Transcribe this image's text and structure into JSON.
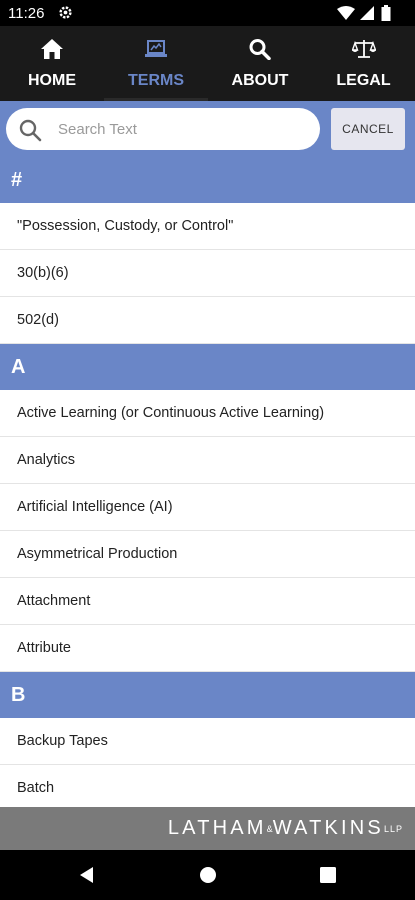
{
  "status_bar": {
    "time": "11:26"
  },
  "nav": {
    "tabs": [
      {
        "label": "HOME",
        "icon": "home-icon",
        "active": false
      },
      {
        "label": "TERMS",
        "icon": "terms-icon",
        "active": true
      },
      {
        "label": "ABOUT",
        "icon": "search-icon",
        "active": false
      },
      {
        "label": "LEGAL",
        "icon": "scales-icon",
        "active": false
      }
    ]
  },
  "search": {
    "placeholder": "Search Text",
    "value": "",
    "cancel_label": "CANCEL"
  },
  "sections": [
    {
      "header": "#",
      "items": [
        "\"Possession, Custody, or Control\"",
        "30(b)(6)",
        "502(d)"
      ]
    },
    {
      "header": "A",
      "items": [
        "Active Learning (or Continuous Active Learning)",
        "Analytics",
        "Artificial Intelligence (AI)",
        "Asymmetrical Production",
        "Attachment",
        "Attribute"
      ]
    },
    {
      "header": "B",
      "items": [
        "Backup Tapes",
        "Batch"
      ]
    }
  ],
  "footer": {
    "logo_left": "LATHAM",
    "logo_amp": "&",
    "logo_right": "WATKINS",
    "logo_suffix": "LLP"
  },
  "colors": {
    "accent": "#6a86c7",
    "nav_bg": "#1a1a1a",
    "footer_bg": "#7a7a7a"
  }
}
